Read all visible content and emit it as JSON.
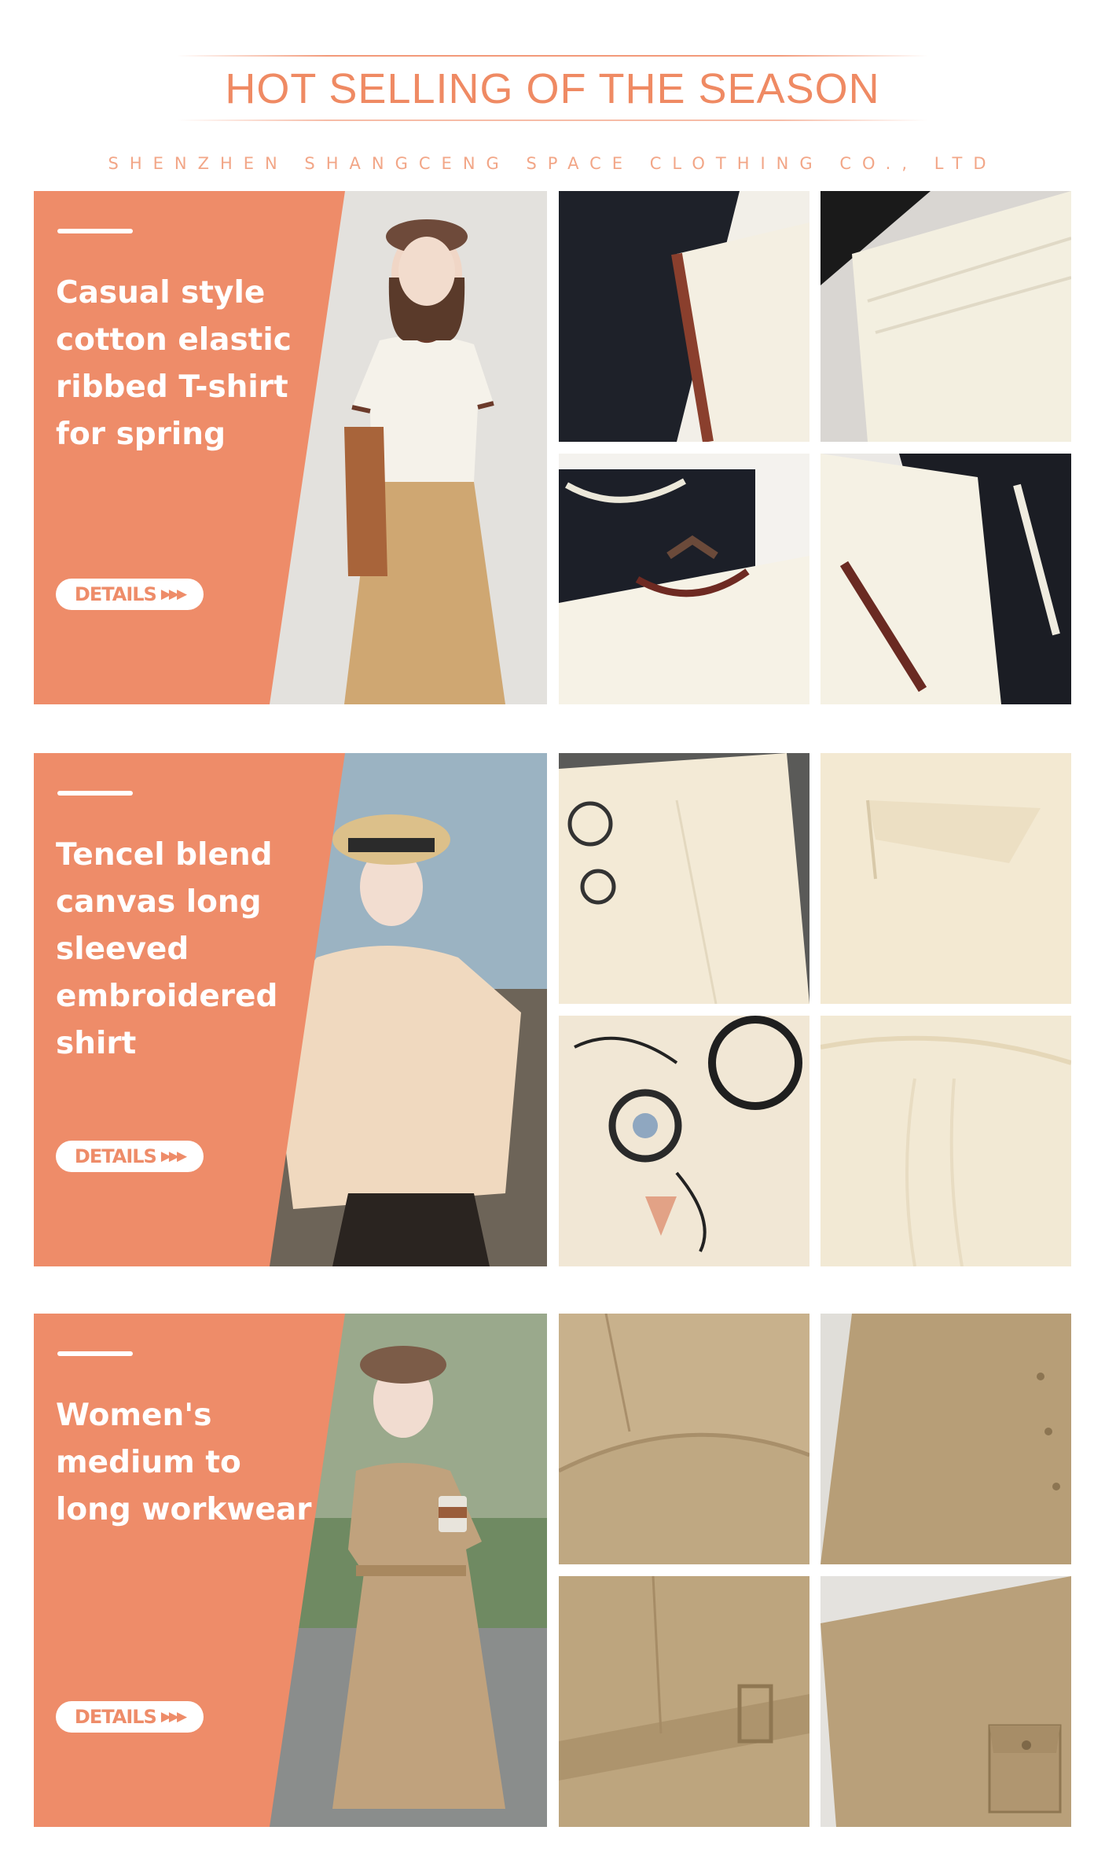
{
  "header": {
    "title": "HOT SELLING OF THE SEASON",
    "subtitle": "SHENZHEN SHANGCENG SPACE CLOTHING CO., LTD"
  },
  "products": [
    {
      "headline": "Casual style cotton elastic ribbed T-shirt for spring",
      "button_label": "DETAILS",
      "button_icon": "triple-chevron-right-icon"
    },
    {
      "headline": "Tencel blend canvas long sleeved embroidered shirt",
      "button_label": "DETAILS",
      "button_icon": "triple-chevron-right-icon"
    },
    {
      "headline": "Women's medium to long workwear",
      "button_label": "DETAILS",
      "button_icon": "triple-chevron-right-icon"
    }
  ],
  "colors": {
    "accent": "#ee8c69",
    "title": "#ef8a63",
    "subtitle": "#f2a687",
    "button_bg": "#ffffff"
  }
}
